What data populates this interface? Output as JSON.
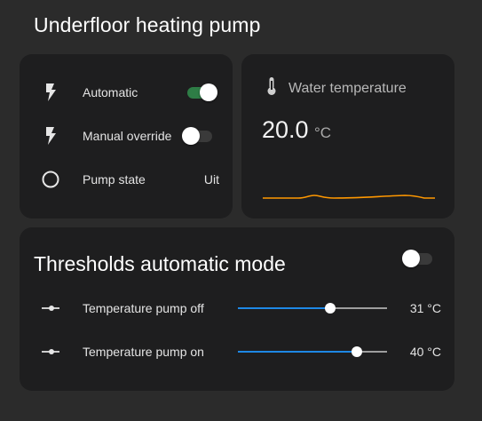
{
  "page": {
    "title": "Underfloor heating pump"
  },
  "controls": {
    "rows": [
      {
        "label": "Automatic",
        "icon": "flash-icon",
        "toggle": true
      },
      {
        "label": "Manual override",
        "icon": "flash-icon",
        "toggle": false
      },
      {
        "label": "Pump state",
        "icon": "circle-outline-icon",
        "value": "Uit"
      }
    ]
  },
  "temperature": {
    "name": "Water temperature",
    "icon": "thermometer-icon",
    "value": "20.0",
    "unit": "°C",
    "sparkline_color": "#ff9800"
  },
  "thresholds": {
    "title": "Thresholds automatic mode",
    "toggle": false,
    "sliders": [
      {
        "label": "Temperature pump off",
        "icon": "slider-icon",
        "value_text": "31 °C",
        "fraction": 0.62
      },
      {
        "label": "Temperature pump on",
        "icon": "slider-icon",
        "value_text": "40 °C",
        "fraction": 0.8
      }
    ]
  },
  "colors": {
    "background": "#2b2b2b",
    "card": "#1e1e1f",
    "toggle_on": "#2e7d46",
    "slider_fill": "#1e88e5"
  }
}
